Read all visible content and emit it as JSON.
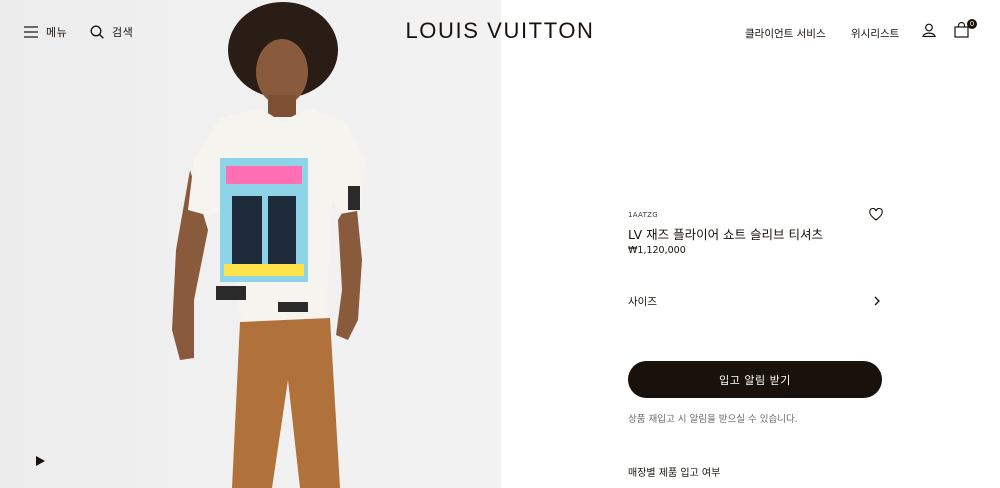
{
  "header": {
    "menu_label": "메뉴",
    "search_label": "검색",
    "logo": "LOUIS VUITTON",
    "client_service": "클라이언트 서비스",
    "wishlist": "위시리스트",
    "bag_count": "0",
    "icons": [
      "menu-icon",
      "search-icon",
      "account-icon",
      "shopping-bag-icon"
    ]
  },
  "media": {
    "play_icon": "play-icon"
  },
  "product": {
    "sku": "1AATZG",
    "title": "LV 재즈 플라이어 쇼트 슬리브 티셔츠",
    "price": "₩1,120,000",
    "size_label": "사이즈",
    "notify_button": "입고 알림 받기",
    "notify_note": "상품 재입고 시 알림을 받으실 수 있습니다.",
    "store_availability": "매장별 제품 입고 여부",
    "wishlist_icon": "heart-icon"
  },
  "colors": {
    "text": "#19110b",
    "button_bg": "#19110b",
    "button_text": "#ffffff",
    "media_bg": "#efefef",
    "note_text": "#6b6b6b"
  }
}
